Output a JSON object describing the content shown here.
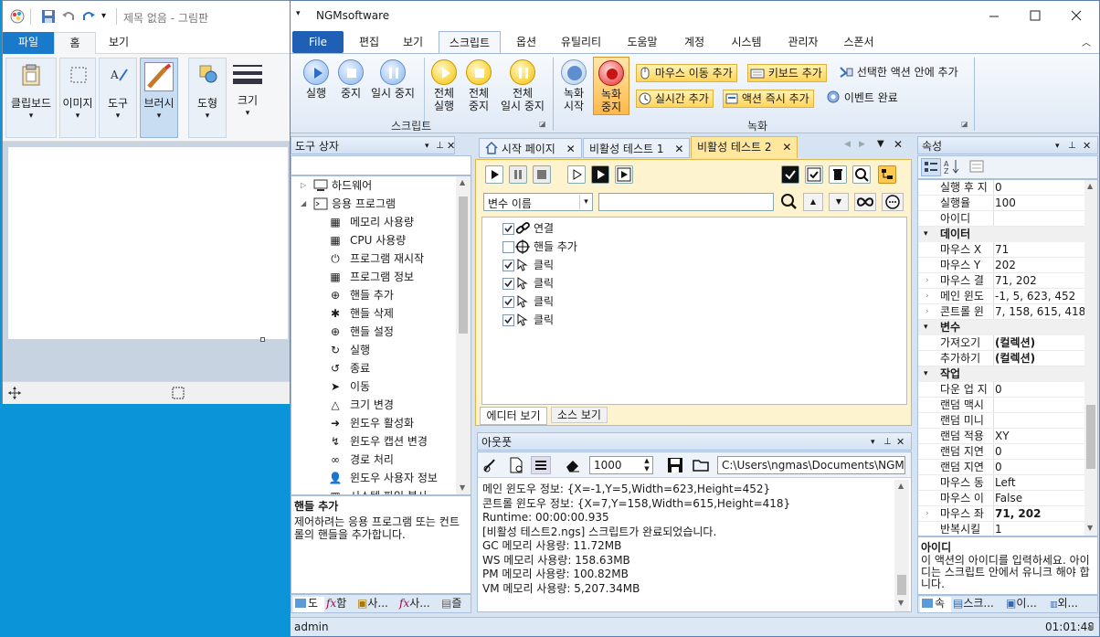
{
  "paint": {
    "title": "제목 없음 - 그림판",
    "tabs": [
      "파일",
      "홈",
      "보기"
    ],
    "tools": [
      "클립보드",
      "이미지",
      "도구",
      "브러시",
      "도형",
      "크기"
    ]
  },
  "app": {
    "title": "NGMsoftware",
    "menu": [
      "File",
      "편집",
      "보기",
      "스크립트",
      "옵션",
      "유틸리티",
      "도움말",
      "계정",
      "시스템",
      "관리자",
      "스폰서"
    ],
    "ribbon": {
      "script_buttons": [
        "실행",
        "중지",
        "일시 중지"
      ],
      "all_buttons": [
        "전체\n실행",
        "전체\n중지",
        "전체\n일시 중지"
      ],
      "script_group": "스크립트",
      "record_buttons": [
        "녹화\n시작",
        "녹화\n중지"
      ],
      "action_buttons": [
        "마우스 이동 추가",
        "키보드 추가",
        "실시간 추가",
        "액션 즉시 추가"
      ],
      "plain_buttons": [
        "선택한 액션 안에 추가",
        "이벤트 완료"
      ],
      "record_group": "녹화"
    },
    "toolbox": {
      "title": "도구 상자",
      "tree": [
        {
          "label": "하드웨어",
          "level": 0,
          "expander": "▷"
        },
        {
          "label": "응용 프로그램",
          "level": 0,
          "expander": "◢"
        }
      ],
      "items": [
        "메모리 사용량",
        "CPU 사용량",
        "프로그램 재시작",
        "프로그램 정보",
        "핸들 추가",
        "핸들 삭제",
        "핸들 설정",
        "실행",
        "종료",
        "이동",
        "크기 변경",
        "윈도우 활성화",
        "윈도우 캡션 변경",
        "경로 처리",
        "윈도우 사용자 정보",
        "시스템 파일 복사"
      ],
      "desc_title": "핸들 추가",
      "desc_text": "제어하려는 응용 프로그램 또는 컨트롤의 핸들을 추가합니다.",
      "bottom_tabs": [
        "도",
        "함",
        "사...",
        "사...",
        "즐"
      ]
    },
    "doc": {
      "tabs": [
        "시작 페이지",
        "비활성 테스트 1",
        "비활성 테스트 2"
      ],
      "var_dropdown": "변수 이름",
      "actions": [
        {
          "label": "연결",
          "checked": true
        },
        {
          "label": "핸들 추가",
          "checked": false
        },
        {
          "label": "클릭",
          "checked": true
        },
        {
          "label": "클릭",
          "checked": true
        },
        {
          "label": "클릭",
          "checked": true
        },
        {
          "label": "클릭",
          "checked": true
        }
      ],
      "view_tabs": [
        "에디터 보기",
        "소스 보기"
      ]
    },
    "output": {
      "title": "아웃풋",
      "count": "1000",
      "path": "C:\\Users\\ngmas\\Documents\\NGM6\\",
      "lines": [
        "메인 윈도우 정보: {X=-1,Y=5,Width=623,Height=452}",
        "콘트롤 윈도우 정보: {X=7,Y=158,Width=615,Height=418}",
        "Runtime: 00:00:00.935",
        "[비활성 테스트2.ngs] 스크립트가 완료되었습니다.",
        "GC 메모리 사용량: 11.72MB",
        "WS 메모리 사용량: 158.63MB",
        "PM 메모리 사용량: 100.82MB",
        "VM 메모리 사용량: 5,207.34MB"
      ]
    },
    "props": {
      "title": "속성",
      "rows": [
        {
          "type": "row",
          "k": "실행 후 지",
          "v": "0"
        },
        {
          "type": "row",
          "k": "실행율",
          "v": "100"
        },
        {
          "type": "row",
          "k": "아이디",
          "v": ""
        },
        {
          "type": "cat",
          "k": "데이터"
        },
        {
          "type": "row",
          "k": "마우스 X",
          "v": "71"
        },
        {
          "type": "row",
          "k": "마우스 Y",
          "v": "202"
        },
        {
          "type": "row",
          "k": "마우스 결",
          "v": "71, 202",
          "exp": true
        },
        {
          "type": "row",
          "k": "메인 윈도",
          "v": "-1, 5, 623, 452",
          "exp": true
        },
        {
          "type": "row",
          "k": "콘트롤 윈",
          "v": "7, 158, 615, 418",
          "exp": true
        },
        {
          "type": "cat",
          "k": "변수"
        },
        {
          "type": "row",
          "k": "가져오기",
          "v": "(컬렉션)",
          "bold": true
        },
        {
          "type": "row",
          "k": "추가하기",
          "v": "(컬렉션)",
          "bold": true
        },
        {
          "type": "cat",
          "k": "작업"
        },
        {
          "type": "row",
          "k": "다운 업 지",
          "v": "0"
        },
        {
          "type": "row",
          "k": "랜덤 맥시",
          "v": ""
        },
        {
          "type": "row",
          "k": "랜덤 미니",
          "v": ""
        },
        {
          "type": "row",
          "k": "랜덤 적용",
          "v": "XY"
        },
        {
          "type": "row",
          "k": "랜덤 지연",
          "v": "0"
        },
        {
          "type": "row",
          "k": "랜덤 지연",
          "v": "0"
        },
        {
          "type": "row",
          "k": "마우스 동",
          "v": "Left"
        },
        {
          "type": "row",
          "k": "마우스 이",
          "v": "False"
        },
        {
          "type": "row",
          "k": "마우스 좌",
          "v": "71, 202",
          "exp": true,
          "bold": true
        },
        {
          "type": "row",
          "k": "반복시킬",
          "v": "1"
        }
      ],
      "desc_title": "아이디",
      "desc_text": "이 액션의 아이디를 입력하세요. 아이디는 스크립트 안에서 유니크 해야 합니다.",
      "bottom_tabs": [
        "속",
        "스크...",
        "이...",
        "외..."
      ]
    },
    "status": {
      "user": "admin",
      "time": "01:01:48"
    }
  }
}
